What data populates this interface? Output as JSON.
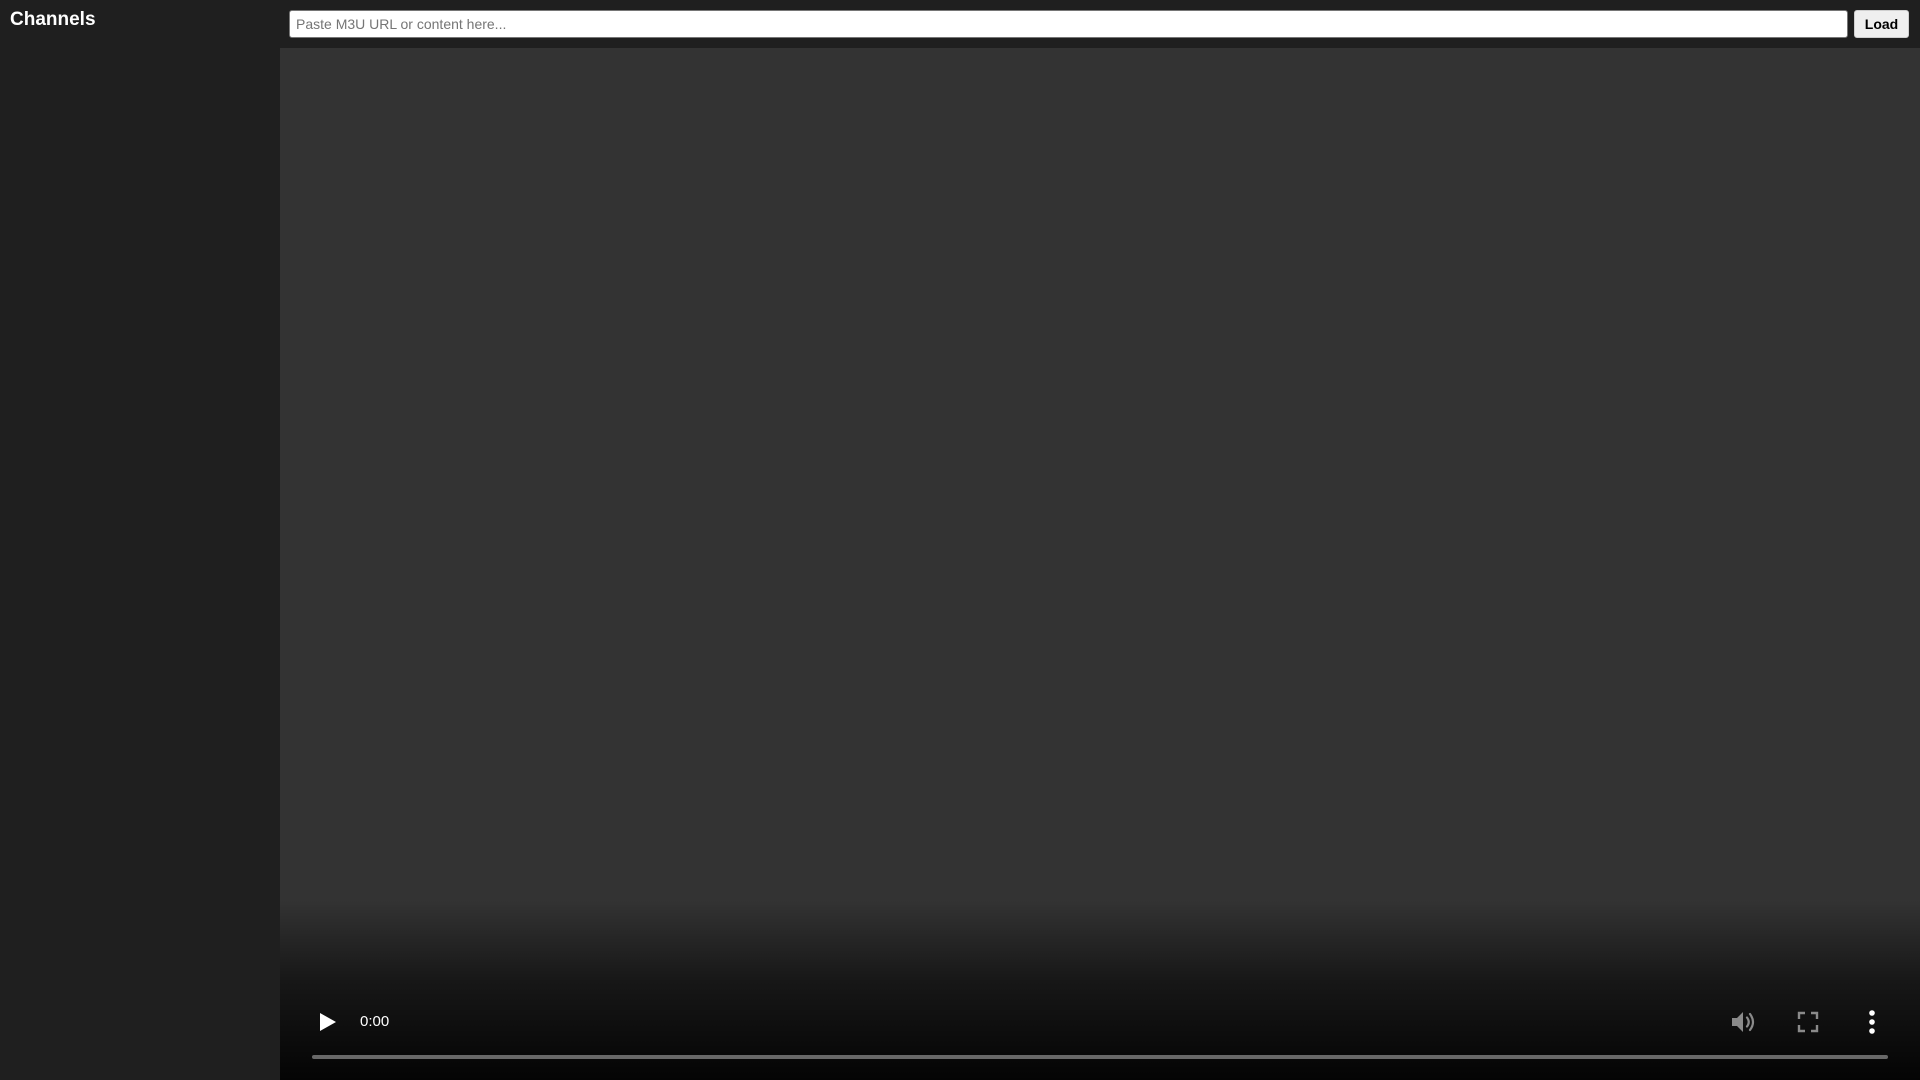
{
  "sidebar": {
    "title": "Channels",
    "channels": []
  },
  "toolbar": {
    "input_placeholder": "Paste M3U URL or content here...",
    "input_value": "",
    "load_label": "Load"
  },
  "player": {
    "current_time": "0:00",
    "progress_fraction": 0,
    "icons": {
      "play": "play-icon",
      "volume": "volume-icon",
      "fullscreen": "fullscreen-icon",
      "more": "more-vertical-icon"
    }
  },
  "colors": {
    "sidebar_bg": "#1f1f1f",
    "video_bg": "#333333",
    "text": "#ffffff"
  }
}
